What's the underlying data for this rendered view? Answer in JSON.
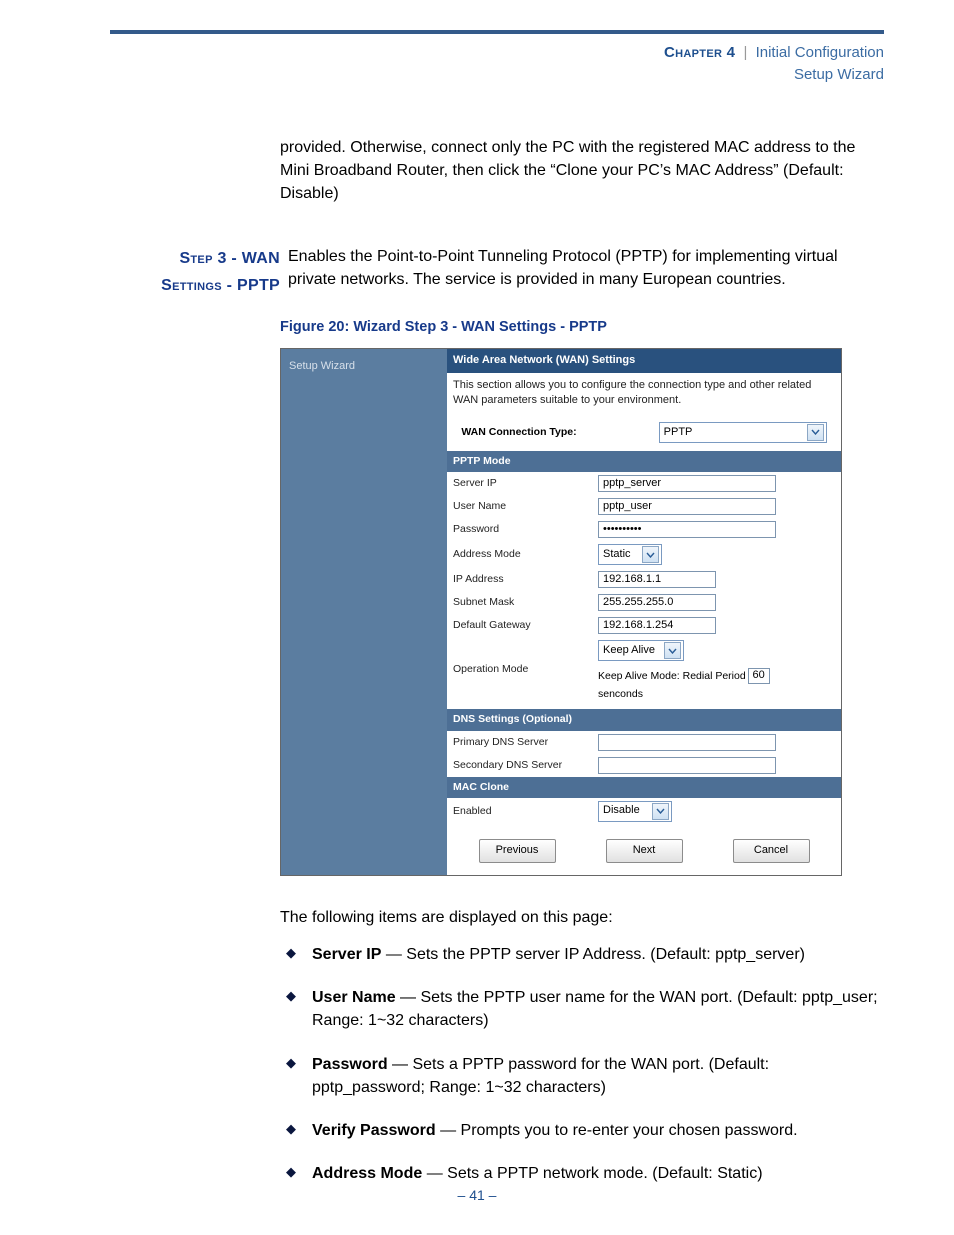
{
  "header": {
    "chapter": "Chapter 4",
    "separator": "|",
    "title": "Initial Configuration",
    "subtitle": "Setup Wizard"
  },
  "intro_continuation": "provided. Otherwise, connect only the PC with the registered MAC address to the Mini Broadband Router, then click the “Clone your PC’s MAC Address” (Default: Disable)",
  "section": {
    "margin_line1": "Step 3 - WAN",
    "margin_line2": "Settings - PPTP",
    "text": "Enables the Point-to-Point Tunneling Protocol (PPTP) for implementing virtual private networks. The service is provided in many European countries."
  },
  "figure_caption": "Figure 20:  Wizard Step 3 - WAN Settings - PPTP",
  "shot": {
    "side_item": "Setup Wizard",
    "wan_header": "Wide Area Network (WAN) Settings",
    "wan_desc": "This section allows you to configure the connection type and other related WAN parameters suitable to your environment.",
    "conn_type_label": "WAN Connection Type:",
    "conn_type_value": "PPTP",
    "band_pptp": "PPTP Mode",
    "rows": {
      "server_ip": {
        "label": "Server IP",
        "value": "pptp_server"
      },
      "user_name": {
        "label": "User Name",
        "value": "pptp_user"
      },
      "password": {
        "label": "Password",
        "value": "••••••••••"
      },
      "addr_mode": {
        "label": "Address Mode",
        "value": "Static"
      },
      "ip": {
        "label": "IP Address",
        "value": "192.168.1.1"
      },
      "subnet": {
        "label": "Subnet Mask",
        "value": "255.255.255.0"
      },
      "gateway": {
        "label": "Default Gateway",
        "value": "192.168.1.254"
      },
      "opmode": {
        "label": "Operation Mode",
        "value": "Keep Alive",
        "line2a": "Keep Alive Mode: Redial Period ",
        "line2_val": "60",
        "line2b": "senconds"
      },
      "pdns": {
        "label": "Primary DNS Server",
        "value": ""
      },
      "sdns": {
        "label": "Secondary DNS Server",
        "value": ""
      },
      "macclone": {
        "label": "Enabled",
        "value": "Disable"
      }
    },
    "band_dns": "DNS Settings (Optional)",
    "band_mac": "MAC Clone",
    "buttons": {
      "previous": "Previous",
      "next": "Next",
      "cancel": "Cancel"
    }
  },
  "after_intro": "The following items are displayed on this page:",
  "bullets": [
    {
      "b": "Server IP",
      "t": " — Sets the PPTP server IP Address. (Default: pptp_server)"
    },
    {
      "b": "User Name",
      "t": " — Sets the PPTP user name for the WAN port. (Default: pptp_user; Range: 1~32 characters)"
    },
    {
      "b": "Password",
      "t": " — Sets a PPTP password for the WAN port. (Default: pptp_password; Range: 1~32 characters)"
    },
    {
      "b": "Verify Password",
      "t": " — Prompts you to re-enter your chosen password."
    },
    {
      "b": "Address Mode",
      "t": " — Sets a PPTP network mode. (Default: Static)"
    }
  ],
  "page_number": "–  41  –"
}
